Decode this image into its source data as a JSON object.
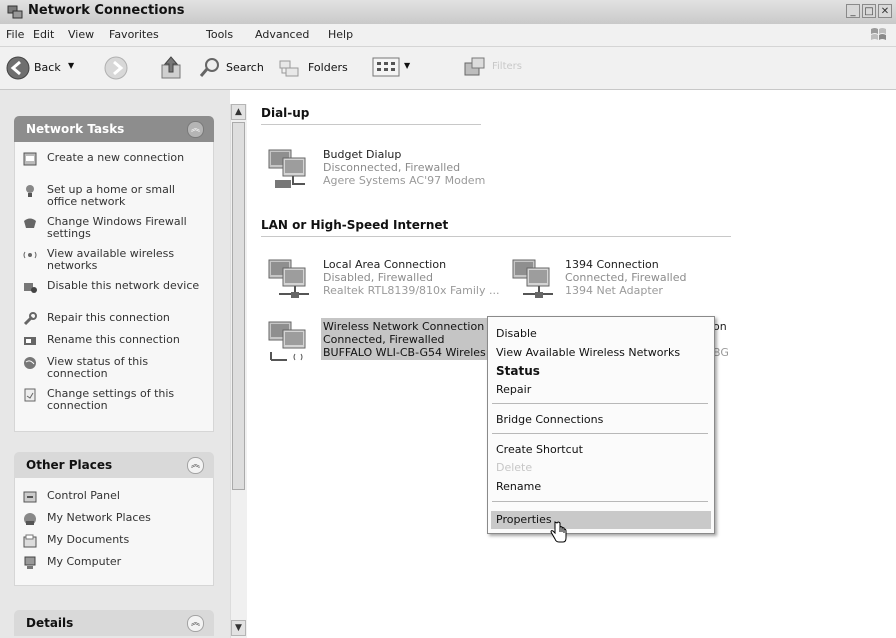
{
  "window": {
    "title": "Network Connections",
    "caption_buttons": [
      "_",
      "□",
      "✕"
    ]
  },
  "menubar": [
    "File",
    "Edit",
    "View",
    "Favorites",
    "Tools",
    "Advanced",
    "Help"
  ],
  "toolbar": {
    "back": "Back",
    "search": "Search",
    "folders": "Folders",
    "faded_label": "Filters"
  },
  "network_tasks": {
    "title": "Network Tasks",
    "items": [
      "Create a new connection",
      "Set up a home or small office network",
      "Change Windows Firewall settings",
      "View available wireless networks",
      "Disable this network device",
      "Repair this connection",
      "Rename this connection",
      "View status of this connection",
      "Change settings of this connection"
    ]
  },
  "other_places": {
    "title": "Other Places",
    "items": [
      "Control Panel",
      "My Network Places",
      "My Documents",
      "My Computer"
    ]
  },
  "details": {
    "title": "Details"
  },
  "groups": {
    "dialup": {
      "title": "Dial-up",
      "connections": [
        {
          "name": "Budget Dialup",
          "status": "Disconnected, Firewalled",
          "device": "Agere Systems AC'97 Modem"
        }
      ]
    },
    "lan": {
      "title": "LAN or High-Speed Internet",
      "connections": [
        {
          "name": "Local Area Connection",
          "status": "Disabled, Firewalled",
          "device": "Realtek RTL8139/810x Family ..."
        },
        {
          "name": "1394 Connection",
          "status": "Connected, Firewalled",
          "device": "1394 Net Adapter"
        },
        {
          "name": "Wireless Network Connection",
          "status": "Connected, Firewalled",
          "device": "BUFFALO WLI-CB-G54 Wireles"
        },
        {
          "name_fragment": "on",
          "device_fragment": "BG"
        }
      ]
    }
  },
  "context_menu": {
    "items": [
      {
        "label": "Disable"
      },
      {
        "label": "View Available Wireless Networks"
      },
      {
        "label": "Status",
        "bold": true
      },
      {
        "label": "Repair"
      },
      {
        "label": "Bridge Connections"
      },
      {
        "label": "Create Shortcut"
      },
      {
        "label": "Delete",
        "disabled": true
      },
      {
        "label": "Rename"
      },
      {
        "label": "Properties",
        "highlighted": true
      }
    ]
  }
}
